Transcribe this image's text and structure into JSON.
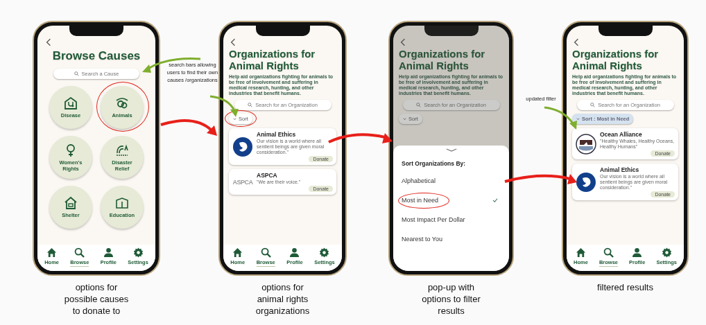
{
  "screens": [
    {
      "kind": "causes",
      "title": "Browse Causes",
      "search": {
        "placeholder": "Search a Cause"
      },
      "causes": [
        {
          "label": "Disease",
          "circled": false
        },
        {
          "label": "Animals",
          "circled": true
        },
        {
          "label": "Women's Rights",
          "circled": false
        },
        {
          "label": "Disaster Relief",
          "circled": false
        },
        {
          "label": "Shelter",
          "circled": false
        },
        {
          "label": "Education",
          "circled": false
        }
      ],
      "nav": [
        {
          "label": "Home",
          "selected": false
        },
        {
          "label": "Browse",
          "selected": true
        },
        {
          "label": "Profile",
          "selected": false
        },
        {
          "label": "Settings",
          "selected": false
        }
      ],
      "caption": [
        "options for",
        "possible causes",
        "to donate to"
      ]
    },
    {
      "kind": "organizations",
      "title": "Organizations for Animal Rights",
      "description": "Help aid organizations fighting for animals to be free of involvement and suffering in medical research, hunting, and other industries that benefit humans.",
      "search": {
        "placeholder": "Search for an Organization"
      },
      "sort": {
        "label": "Sort",
        "active": false,
        "circled": true
      },
      "organizations": [
        {
          "name": "Animal Ethics",
          "quote": "Our vision is a world where all sentient beings are given moral consideration.\"",
          "donate": "Donate",
          "logo": {
            "kind": "emblem"
          }
        },
        {
          "name": "ASPCA",
          "quote": "\"We are their voice.\"",
          "donate": "Donate",
          "logo": {
            "kind": "wordmark",
            "text": "ASPCA"
          }
        }
      ],
      "nav": [
        {
          "label": "Home",
          "selected": false
        },
        {
          "label": "Browse",
          "selected": true
        },
        {
          "label": "Profile",
          "selected": false
        },
        {
          "label": "Settings",
          "selected": false
        }
      ],
      "caption": [
        "options for",
        "animal rights",
        "organizations"
      ]
    },
    {
      "kind": "sort_sheet",
      "title": "Organizations for Animal Rights",
      "description": "Help aid organizations fighting for animals to be free of involvement and suffering in medical research, hunting, and other industries that benefit humans.",
      "search": {
        "placeholder": "Search for an Organization"
      },
      "sort": {
        "label": "Sort",
        "active": false,
        "circled": false
      },
      "sheet": {
        "title": "Sort Organizations By:",
        "options": [
          {
            "label": "Alphabetical",
            "selected": false,
            "circled": false
          },
          {
            "label": "Most in Need",
            "selected": true,
            "circled": true
          },
          {
            "label": "Most Impact Per Dollar",
            "selected": false,
            "circled": false
          },
          {
            "label": "Nearest to You",
            "selected": false,
            "circled": false
          }
        ]
      },
      "caption": [
        "pop-up with",
        "options to filter",
        "results"
      ]
    },
    {
      "kind": "organizations",
      "title": "Organizations for Animal Rights",
      "description": "Help aid organizations fighting for animals to be free of involvement and suffering in medical research, hunting, and other industries that benefit humans.",
      "search": {
        "placeholder": "Search for an Organization"
      },
      "sort": {
        "label": "Sort : Most in Need",
        "active": true,
        "circled": false
      },
      "organizations": [
        {
          "name": "Ocean Alliance",
          "quote": "\"Healthy Whales, Healthy Oceans, Healthy Humans\"",
          "donate": "Donate",
          "logo": {
            "kind": "seal"
          }
        },
        {
          "name": "Animal Ethics",
          "quote": "Our vision is a world where all sentient beings are given moral consideration.\"",
          "donate": "Donate",
          "logo": {
            "kind": "emblem"
          }
        }
      ],
      "nav": [
        {
          "label": "Home",
          "selected": false
        },
        {
          "label": "Browse",
          "selected": true
        },
        {
          "label": "Profile",
          "selected": false
        },
        {
          "label": "Settings",
          "selected": false
        }
      ],
      "caption": [
        "filtered results"
      ]
    }
  ],
  "annotations": [
    {
      "text": "search bars allowing users to find their own causes /organizations"
    },
    {
      "text": "updated filter"
    }
  ]
}
